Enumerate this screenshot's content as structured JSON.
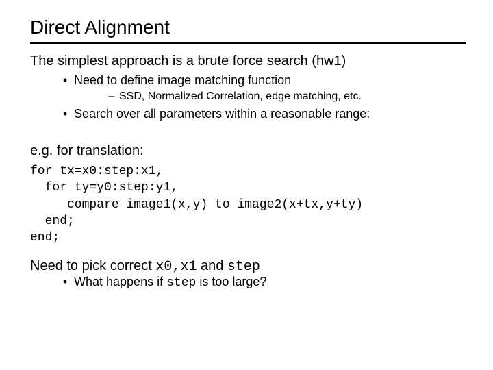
{
  "title": "Direct Alignment",
  "intro": "The simplest approach is a brute force search (hw1)",
  "bullet1": "Need to define image matching function",
  "subbullet1": "SSD, Normalized Correlation, edge matching, etc.",
  "bullet2": "Search over all parameters within a reasonable range:",
  "example_label": "e.g. for translation:",
  "code": "for tx=x0:step:x1,\n  for ty=y0:step:y1,\n     compare image1(x,y) to image2(x+tx,y+ty)\n  end;\nend;",
  "closing": {
    "pre": "Need to pick correct ",
    "mono1": "x0,x1",
    "mid": " and ",
    "mono2": "step"
  },
  "closing_bullet": {
    "pre": "What happens if ",
    "mono": "step",
    "post": " is too large?"
  }
}
